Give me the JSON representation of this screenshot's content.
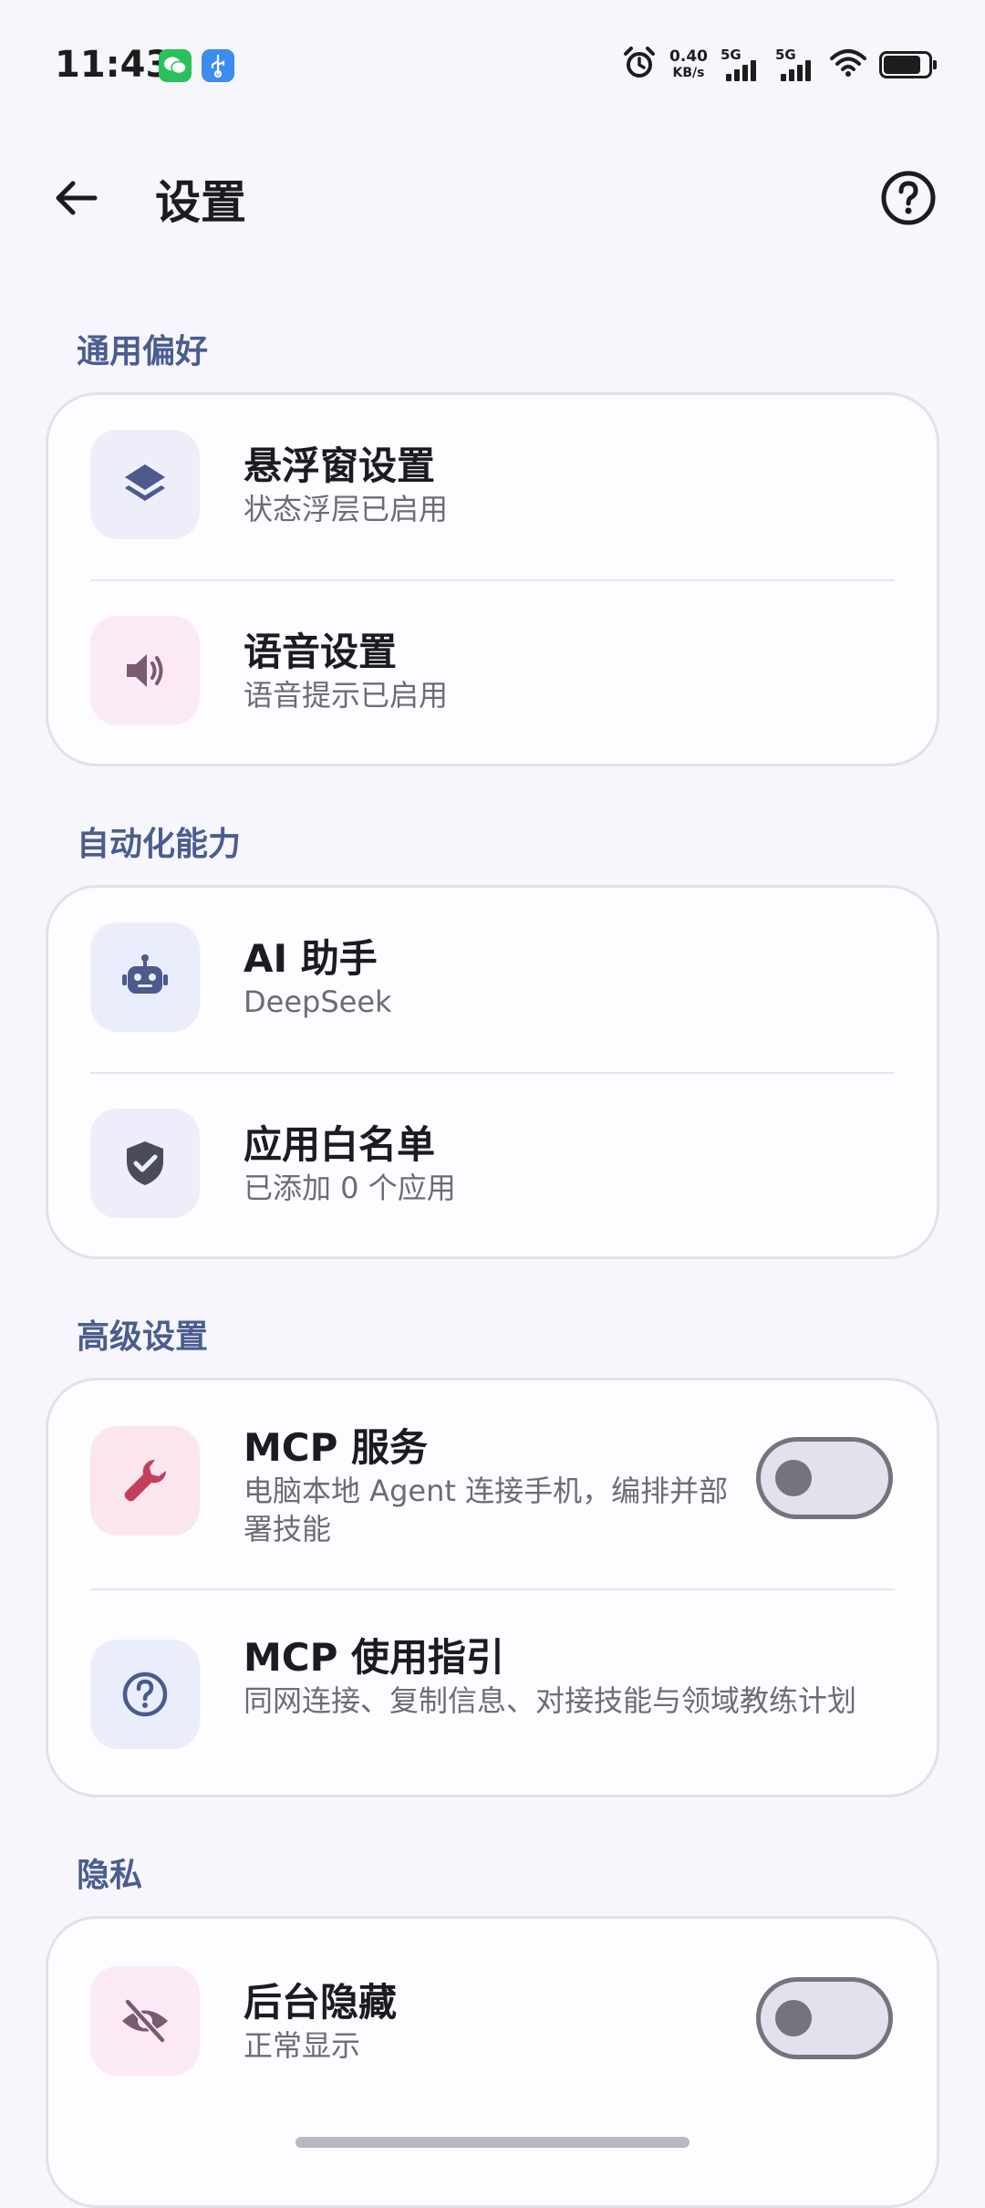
{
  "status_bar": {
    "time": "11:43",
    "speed_value": "0.40",
    "speed_unit": "KB/s",
    "net1": "5G",
    "net2": "5G",
    "apps": [
      "wechat-icon",
      "usb-icon"
    ]
  },
  "header": {
    "title": "设置",
    "back_icon": "back-arrow-icon",
    "help_icon": "help-circle-icon"
  },
  "sections": [
    {
      "label": "通用偏好",
      "items": [
        {
          "title": "悬浮窗设置",
          "subtitle": "状态浮层已启用",
          "icon": "layers-icon",
          "icon_bg": "#eeeefa"
        },
        {
          "title": "语音设置",
          "subtitle": "语音提示已启用",
          "icon": "speaker-icon",
          "icon_bg": "#fbeaf6"
        }
      ]
    },
    {
      "label": "自动化能力",
      "items": [
        {
          "title": "AI 助手",
          "subtitle": "DeepSeek",
          "icon": "robot-icon",
          "icon_bg": "#eaeefc"
        },
        {
          "title": "应用白名单",
          "subtitle": "已添加 0 个应用",
          "icon": "shield-check-icon",
          "icon_bg": "#eeeefa"
        }
      ]
    },
    {
      "label": "高级设置",
      "items": [
        {
          "title": "MCP 服务",
          "subtitle": "电脑本地 Agent 连接手机，编排并部署技能",
          "icon": "wrench-icon",
          "icon_bg": "#fbe6ee",
          "toggle": false
        },
        {
          "title": "MCP 使用指引",
          "subtitle": "同网连接、复制信息、对接技能与领域教练计划",
          "icon": "question-circle-icon",
          "icon_bg": "#eaeefc"
        }
      ]
    },
    {
      "label": "隐私",
      "items": [
        {
          "title": "后台隐藏",
          "subtitle": "正常显示",
          "icon": "eye-off-icon",
          "icon_bg": "#fbeaf6",
          "toggle": false
        }
      ]
    }
  ],
  "colors": {
    "accent_label": "#4a5d8f",
    "icon_primary": "#4c5a8c",
    "icon_speaker": "#7a5a70",
    "icon_wrench": "#c2405c",
    "background": "#f7f6fc",
    "card": "#fdfcff"
  }
}
